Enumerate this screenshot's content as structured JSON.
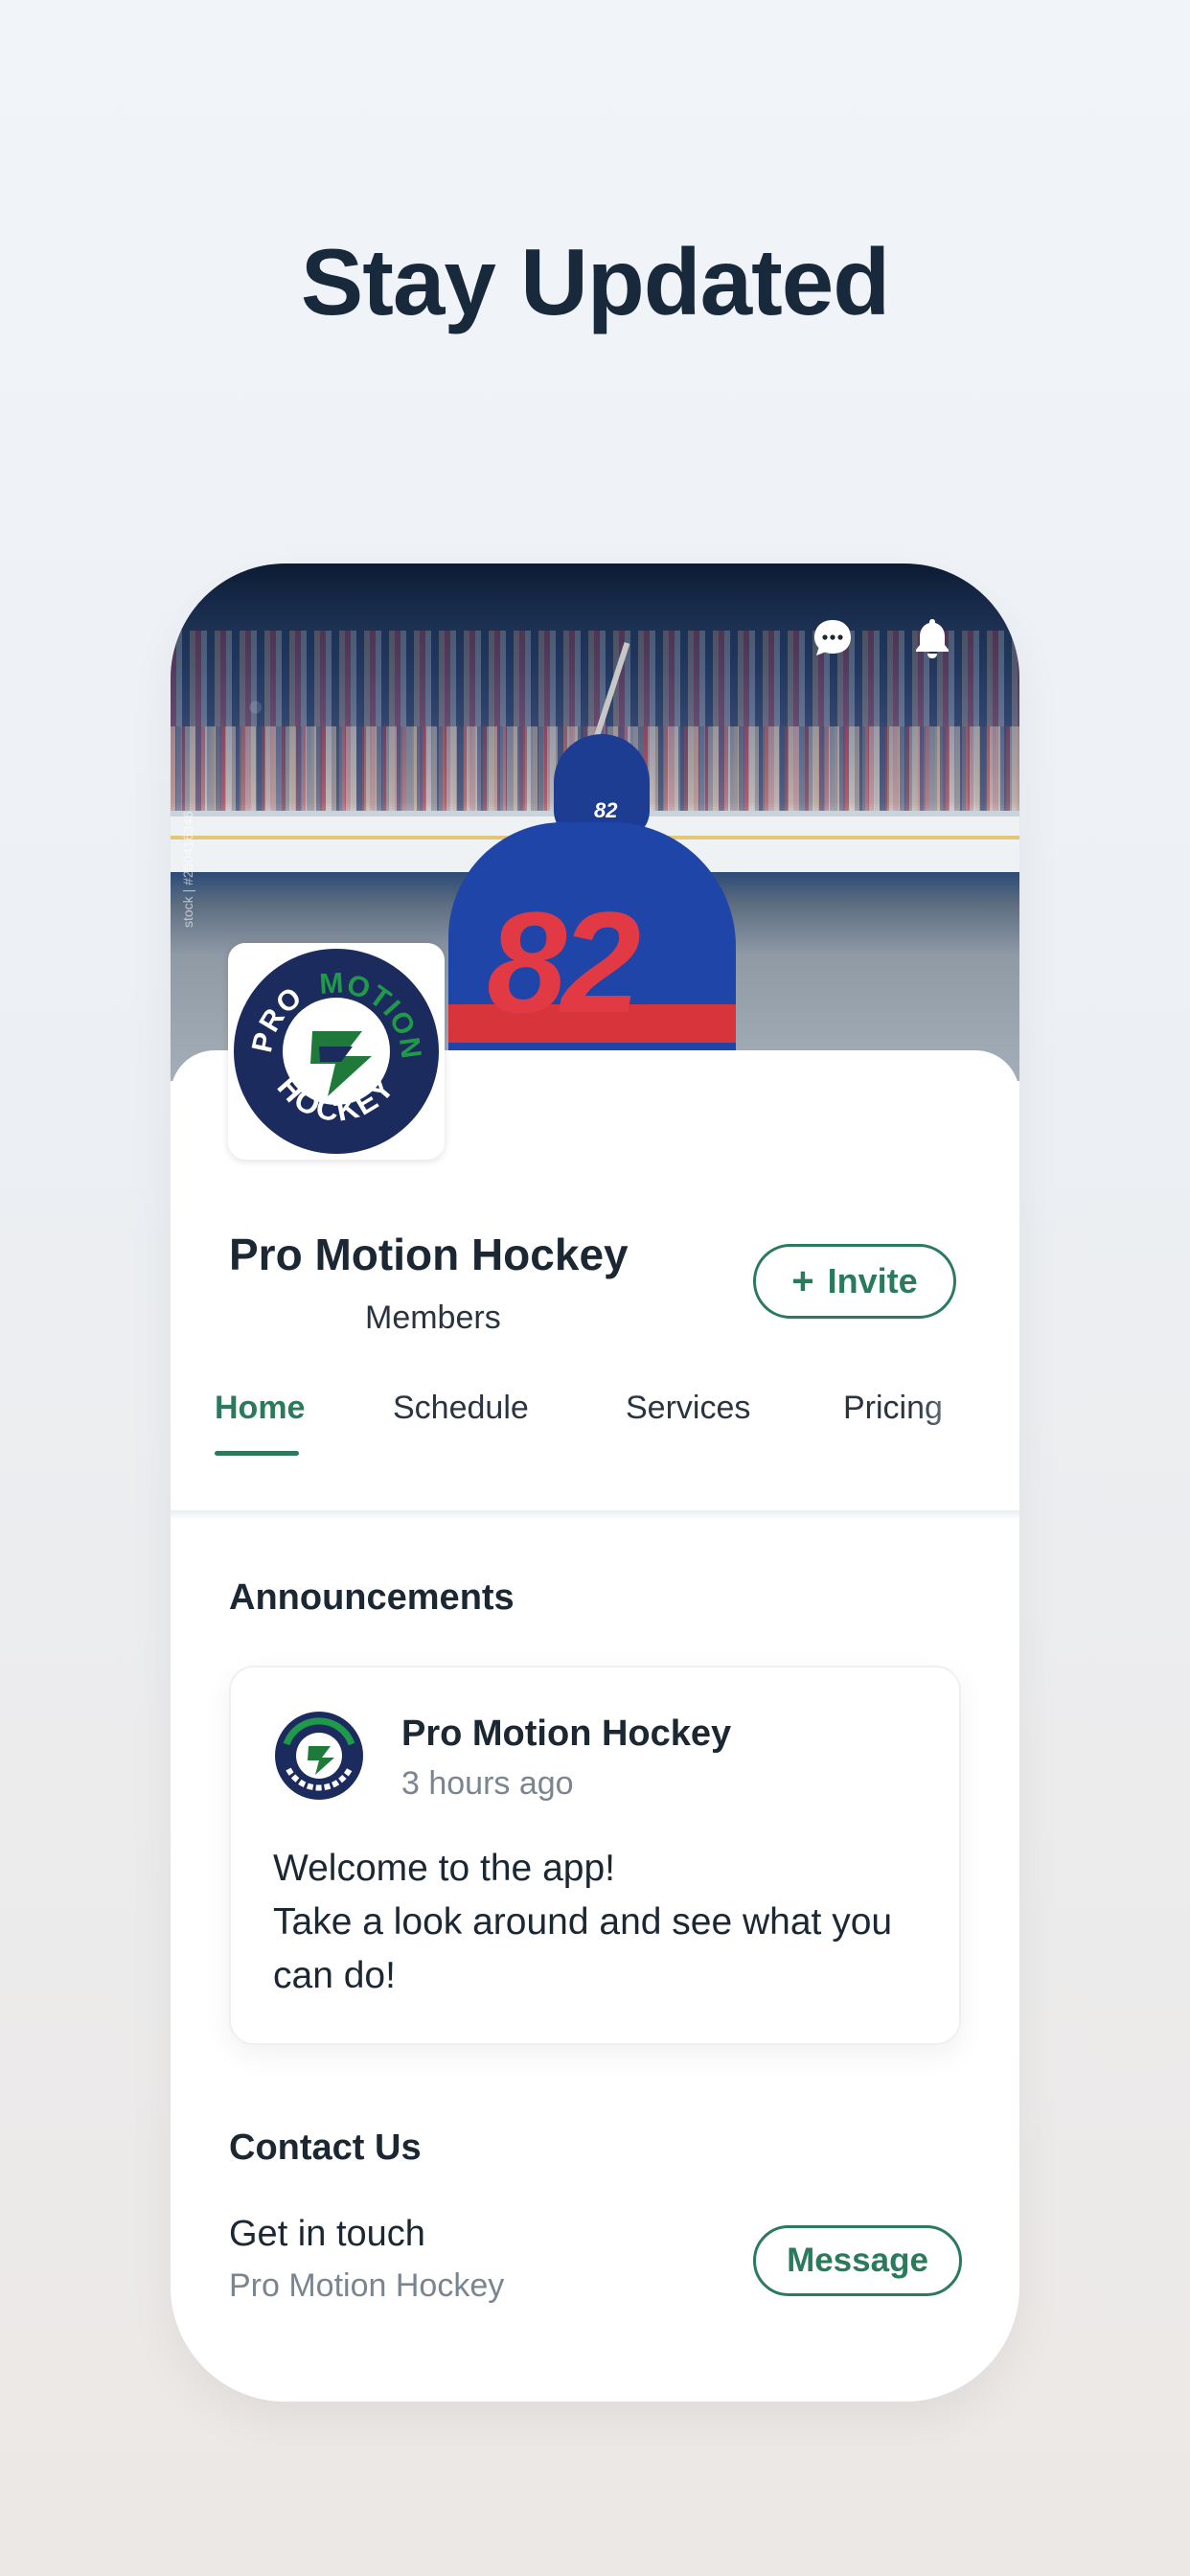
{
  "headline": "Stay Updated",
  "cover": {
    "player_number": "82",
    "watermark": "stock | #250416346"
  },
  "header_icons": [
    "chat-bubble-icon",
    "bell-icon"
  ],
  "group": {
    "name": "Pro Motion Hockey",
    "members_label": "Members",
    "invite_label": "Invite",
    "logo": {
      "top": "PRO",
      "arc": "MOTION",
      "bottom": "HOCKEY"
    }
  },
  "tabs": [
    {
      "label": "Home",
      "active": true
    },
    {
      "label": "Schedule",
      "active": false
    },
    {
      "label": "Services",
      "active": false
    },
    {
      "label": "Pricing",
      "active": false
    }
  ],
  "announcements": {
    "title": "Announcements",
    "post": {
      "author": "Pro Motion Hockey",
      "time": "3 hours ago",
      "line1": "Welcome to the app!",
      "line2": "Take a look around and see what you can do!"
    }
  },
  "contact": {
    "title": "Contact Us",
    "line1": "Get in touch",
    "line2": "Pro Motion Hockey",
    "button_label": "Message"
  },
  "colors": {
    "accent": "#2b7a5c",
    "text": "#1b2733",
    "muted": "#7b8590",
    "logo_navy": "#1c2b5e",
    "logo_green": "#1f7a3a"
  }
}
